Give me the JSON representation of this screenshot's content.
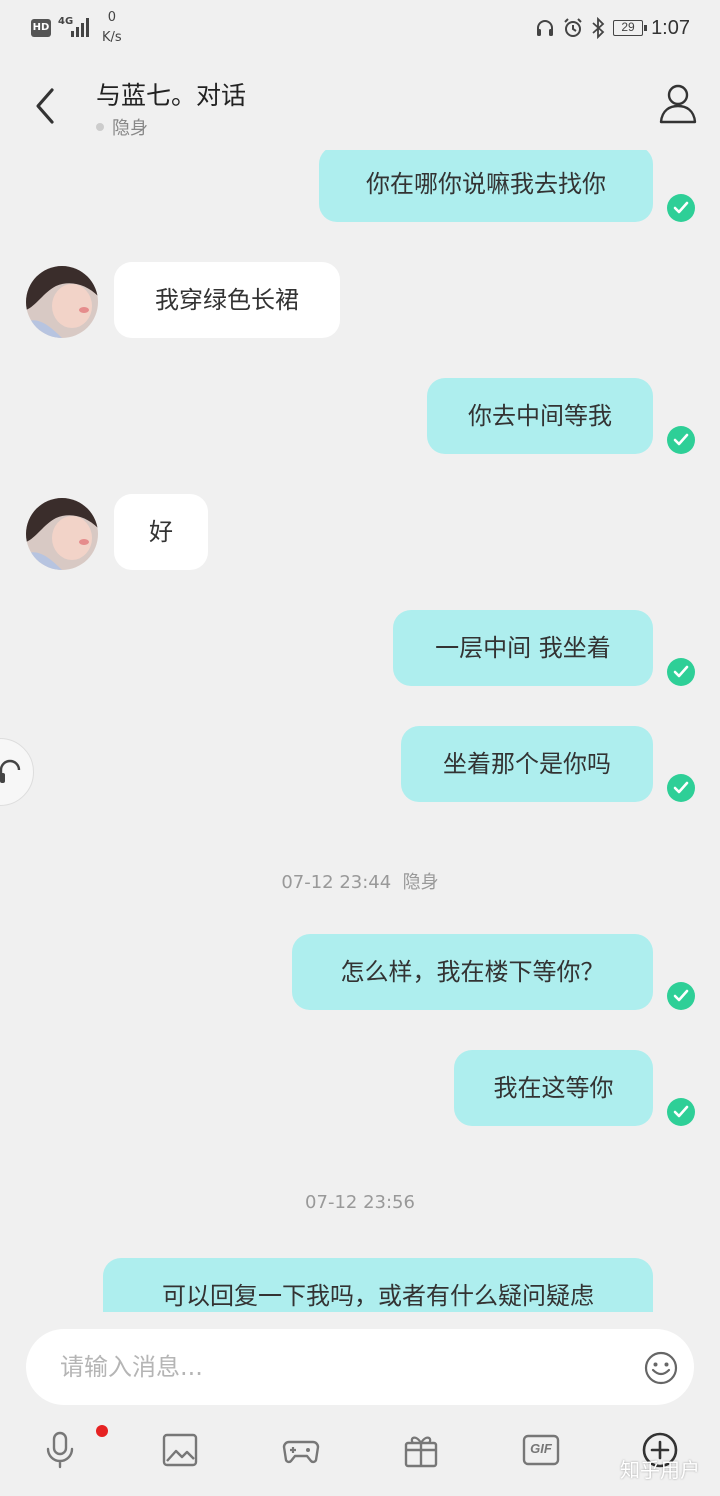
{
  "status_bar": {
    "hd": "HD",
    "network": "4G",
    "speed_value": "0",
    "speed_unit": "K/s",
    "battery": "29",
    "time": "1:07"
  },
  "header": {
    "title": "与蓝七。对话",
    "presence": "隐身"
  },
  "messages": [
    {
      "side": "out",
      "text": "你在哪你说嘛我去找你",
      "status": "read"
    },
    {
      "side": "in",
      "text": "我穿绿色长裙"
    },
    {
      "side": "out",
      "text": "你去中间等我",
      "status": "read"
    },
    {
      "side": "in",
      "text": "好"
    },
    {
      "side": "out",
      "text": "一层中间 我坐着",
      "status": "read"
    },
    {
      "side": "out",
      "text": "坐着那个是你吗",
      "status": "read"
    },
    {
      "type": "timestamp",
      "time": "07-12 23:44",
      "note": "隐身"
    },
    {
      "side": "out",
      "text": "怎么样，我在楼下等你？",
      "status": "read"
    },
    {
      "side": "out",
      "text": "我在这等你",
      "status": "read"
    },
    {
      "type": "timestamp",
      "time": "07-12 23:56"
    },
    {
      "side": "out",
      "text": "可以回复一下我吗，或者有什么疑问疑虑"
    }
  ],
  "input": {
    "placeholder": "请输入消息..."
  },
  "toolbar": {
    "items": [
      "mic-icon",
      "image-icon",
      "gamepad-icon",
      "gift-icon",
      "gif-icon",
      "plus-icon"
    ],
    "gif_label": "GIF"
  },
  "watermark": "知乎用户",
  "colors": {
    "outgoing_bubble": "#aeeeee",
    "incoming_bubble": "#ffffff",
    "read_check": "#2ecf97",
    "background": "#f0f0f0",
    "notification_dot": "#e62222"
  }
}
